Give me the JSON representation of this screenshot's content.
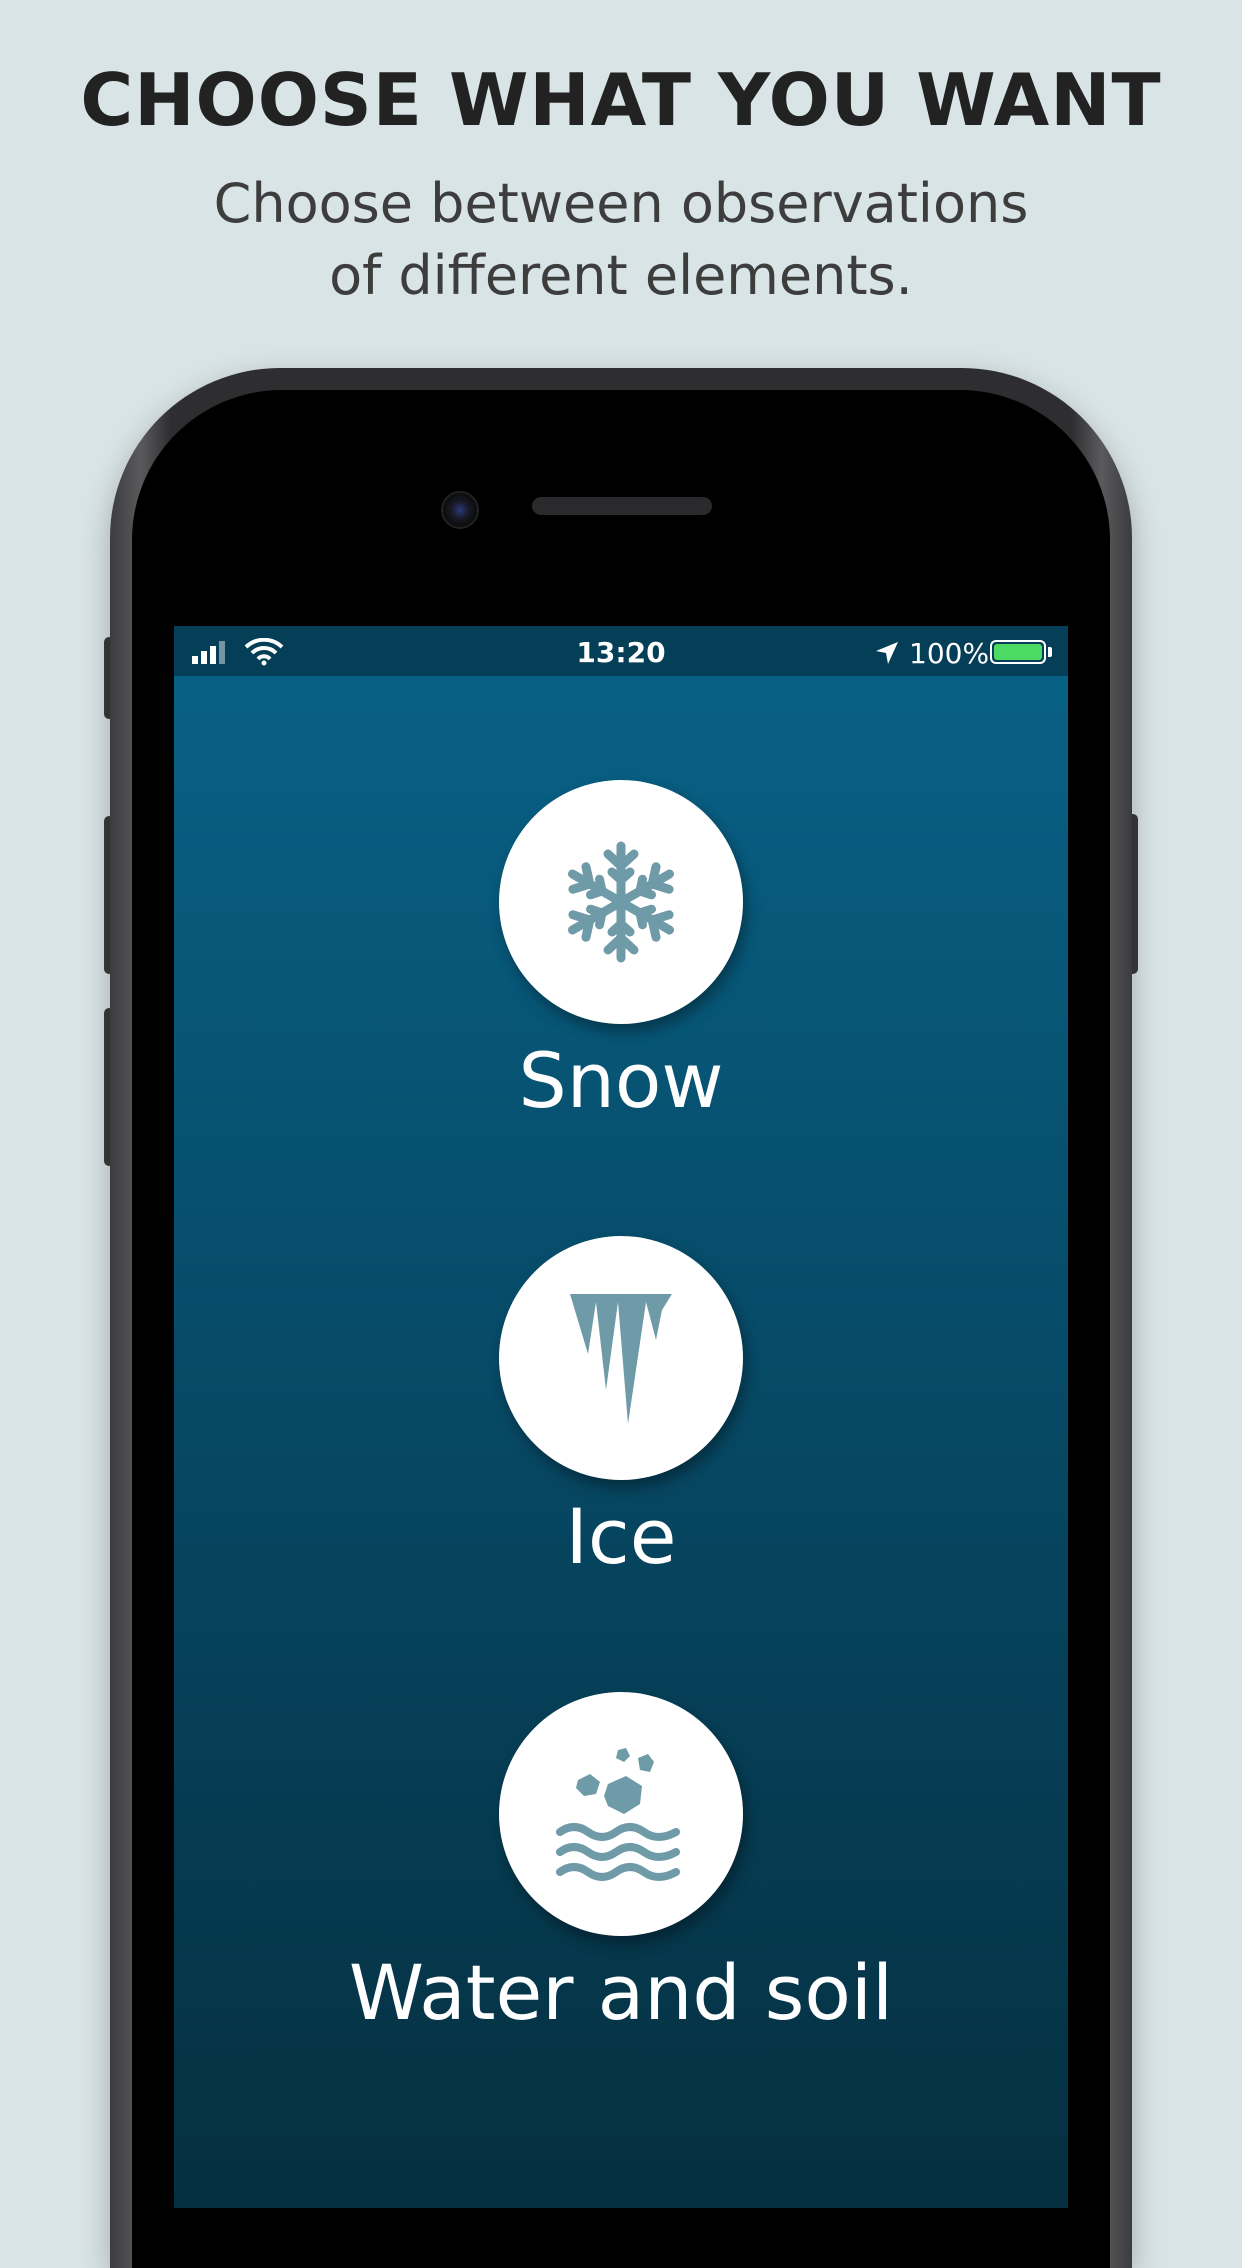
{
  "header": {
    "title": "CHOOSE WHAT YOU WANT",
    "subtitle_line1": "Choose between observations",
    "subtitle_line2": "of different elements."
  },
  "status_bar": {
    "time": "13:20",
    "battery_percent": "100%",
    "battery_level": 1.0,
    "icons": [
      "signal-icon",
      "wifi-icon",
      "location-arrow-icon",
      "battery-icon"
    ]
  },
  "options": [
    {
      "label": "Snow",
      "icon": "snowflake-icon"
    },
    {
      "label": "Ice",
      "icon": "icicle-icon"
    },
    {
      "label": "Water and soil",
      "icon": "water-soil-icon"
    }
  ],
  "colors": {
    "background": "#d9e4e6",
    "screen_top": "#086287",
    "screen_bottom": "#052f40",
    "icon": "#6f9aa8",
    "battery": "#4cd964"
  }
}
